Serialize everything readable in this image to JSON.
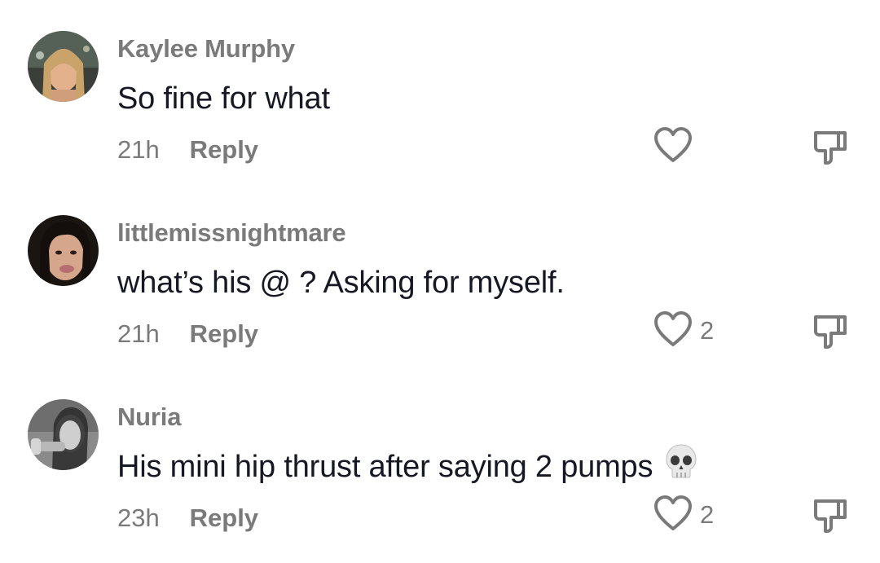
{
  "comments": [
    {
      "username": "Kaylee Murphy",
      "text": "So fine for what",
      "time": "21h",
      "reply_label": "Reply",
      "like_count": "",
      "emoji": ""
    },
    {
      "username": "littlemissnightmare",
      "text": "what’s his @ ? Asking for myself.",
      "time": "21h",
      "reply_label": "Reply",
      "like_count": "2",
      "emoji": ""
    },
    {
      "username": "Nuria",
      "text": "His mini hip thrust after saying 2 pumps",
      "time": "23h",
      "reply_label": "Reply",
      "like_count": "2",
      "emoji": "skull-icon"
    }
  ],
  "colors": {
    "primary_text": "#161823",
    "secondary_text": "#7a7a7a",
    "icon_stroke": "#7a7a7a",
    "background": "#ffffff"
  },
  "icons": {
    "like": "heart-outline-icon",
    "dislike": "thumbs-down-outline-icon"
  }
}
